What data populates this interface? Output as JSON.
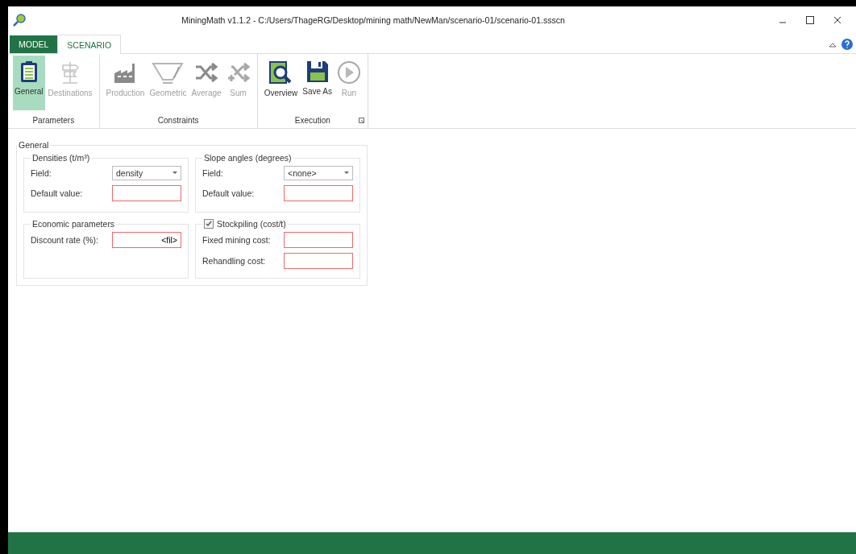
{
  "window": {
    "title": "MiningMath v1.1.2 - C:/Users/ThageRG/Desktop/mining math/NewMan/scenario-01/scenario-01.ssscn"
  },
  "tabs": [
    {
      "label": "MODEL",
      "selected": false
    },
    {
      "label": "SCENARIO",
      "selected": true
    }
  ],
  "ribbon_groups": [
    {
      "label": "Parameters",
      "buttons": [
        {
          "label": "General",
          "selected": true,
          "disabled": false
        },
        {
          "label": "Destinations",
          "selected": false,
          "disabled": true
        }
      ]
    },
    {
      "label": "Constraints",
      "buttons": [
        {
          "label": "Production",
          "selected": false,
          "disabled": true
        },
        {
          "label": "Geometric",
          "selected": false,
          "disabled": true
        },
        {
          "label": "Average",
          "selected": false,
          "disabled": true
        },
        {
          "label": "Sum",
          "selected": false,
          "disabled": true
        }
      ]
    },
    {
      "label": "Execution",
      "launcher": true,
      "buttons": [
        {
          "label": "Overview",
          "selected": false,
          "disabled": false
        },
        {
          "label": "Save As",
          "selected": false,
          "disabled": false
        },
        {
          "label": "Run",
          "selected": false,
          "disabled": true
        }
      ]
    }
  ],
  "general": {
    "title": "General",
    "sections": [
      {
        "title": "Densities (t/m³)",
        "rows": [
          {
            "kind": "combo",
            "label": "Field:",
            "value": "density"
          },
          {
            "kind": "text",
            "label": "Default value:",
            "value": "",
            "invalid": true
          }
        ]
      },
      {
        "title": "Slope angles (degrees)",
        "rows": [
          {
            "kind": "combo",
            "label": "Field:",
            "value": "<none>"
          },
          {
            "kind": "text",
            "label": "Default value:",
            "value": "",
            "invalid": true
          }
        ]
      },
      {
        "title": "Economic parameters",
        "rows": [
          {
            "kind": "text",
            "label": "Discount rate (%):",
            "value": "<fil>",
            "invalid": true
          }
        ]
      },
      {
        "title": "Stockpiling (cost/t)",
        "checked": true,
        "rows": [
          {
            "kind": "text",
            "label": "Fixed mining cost:",
            "value": "",
            "invalid": true
          },
          {
            "kind": "text",
            "label": "Rehandling cost:",
            "value": "",
            "invalid": true
          }
        ]
      }
    ]
  }
}
